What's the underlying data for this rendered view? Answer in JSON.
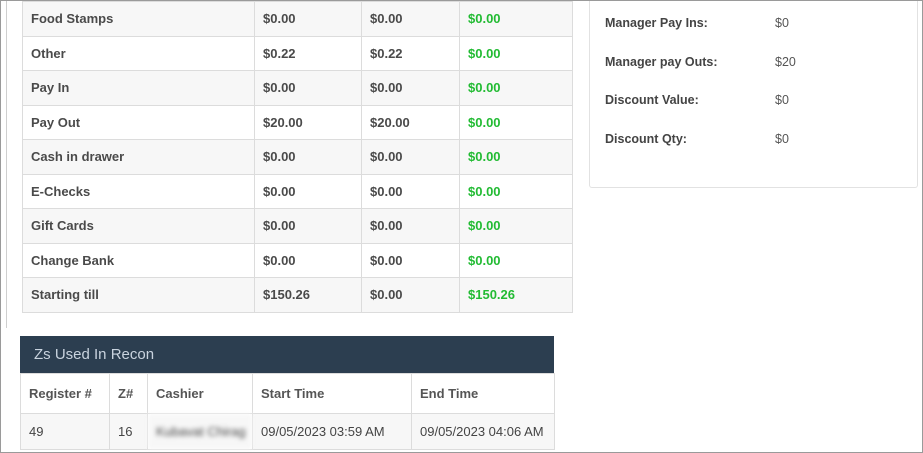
{
  "recon_rows": [
    {
      "label": "Food Stamps",
      "v1": "$0.00",
      "v2": "$0.00",
      "diff": "$0.00"
    },
    {
      "label": "Other",
      "v1": "$0.22",
      "v2": "$0.22",
      "diff": "$0.00"
    },
    {
      "label": "Pay In",
      "v1": "$0.00",
      "v2": "$0.00",
      "diff": "$0.00"
    },
    {
      "label": "Pay Out",
      "v1": "$20.00",
      "v2": "$20.00",
      "diff": "$0.00"
    },
    {
      "label": "Cash in drawer",
      "v1": "$0.00",
      "v2": "$0.00",
      "diff": "$0.00"
    },
    {
      "label": "E-Checks",
      "v1": "$0.00",
      "v2": "$0.00",
      "diff": "$0.00"
    },
    {
      "label": "Gift Cards",
      "v1": "$0.00",
      "v2": "$0.00",
      "diff": "$0.00"
    },
    {
      "label": "Change Bank",
      "v1": "$0.00",
      "v2": "$0.00",
      "diff": "$0.00"
    },
    {
      "label": "Starting till",
      "v1": "$150.26",
      "v2": "$0.00",
      "diff": "$150.26"
    }
  ],
  "summary": [
    {
      "label": "Manager Pay Ins:",
      "value": "$0"
    },
    {
      "label": "Manager pay Outs:",
      "value": "$20"
    },
    {
      "label": "Discount Value:",
      "value": "$0"
    },
    {
      "label": "Discount Qty:",
      "value": "$0"
    }
  ],
  "zs_section": {
    "title": "Zs Used In Recon",
    "columns": [
      "Register #",
      "Z#",
      "Cashier",
      "Start Time",
      "End Time"
    ],
    "rows": [
      {
        "register": "49",
        "z": "16",
        "cashier": "Kubavat Chirag",
        "start": "09/05/2023 03:59 AM",
        "end": "09/05/2023 04:06 AM"
      }
    ]
  },
  "colors": {
    "positive": "#22bb33",
    "header_bg": "#2c3e50"
  }
}
